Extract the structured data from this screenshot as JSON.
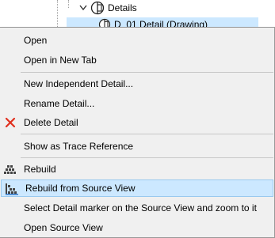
{
  "tree": {
    "folder_label": "Details",
    "selected_label": "D_01 Detail (Drawing)"
  },
  "menu": {
    "items": [
      {
        "label": "Open"
      },
      {
        "label": "Open in New Tab"
      },
      {
        "label": "New Independent Detail..."
      },
      {
        "label": "Rename Detail..."
      },
      {
        "label": "Delete Detail",
        "icon": "delete-x-icon"
      },
      {
        "label": "Show as Trace Reference"
      },
      {
        "label": "Rebuild",
        "icon": "rebuild-icon"
      },
      {
        "label": "Rebuild from Source View",
        "icon": "rebuild-from-source-icon",
        "highlighted": true
      },
      {
        "label": "Select Detail marker on the Source View and zoom to it"
      },
      {
        "label": "Open Source View"
      }
    ]
  },
  "colors": {
    "menu_bg": "#f0f0f0",
    "highlight_bg": "#cce8ff",
    "highlight_border": "#99c9ef",
    "delete_red": "#e0301e"
  }
}
